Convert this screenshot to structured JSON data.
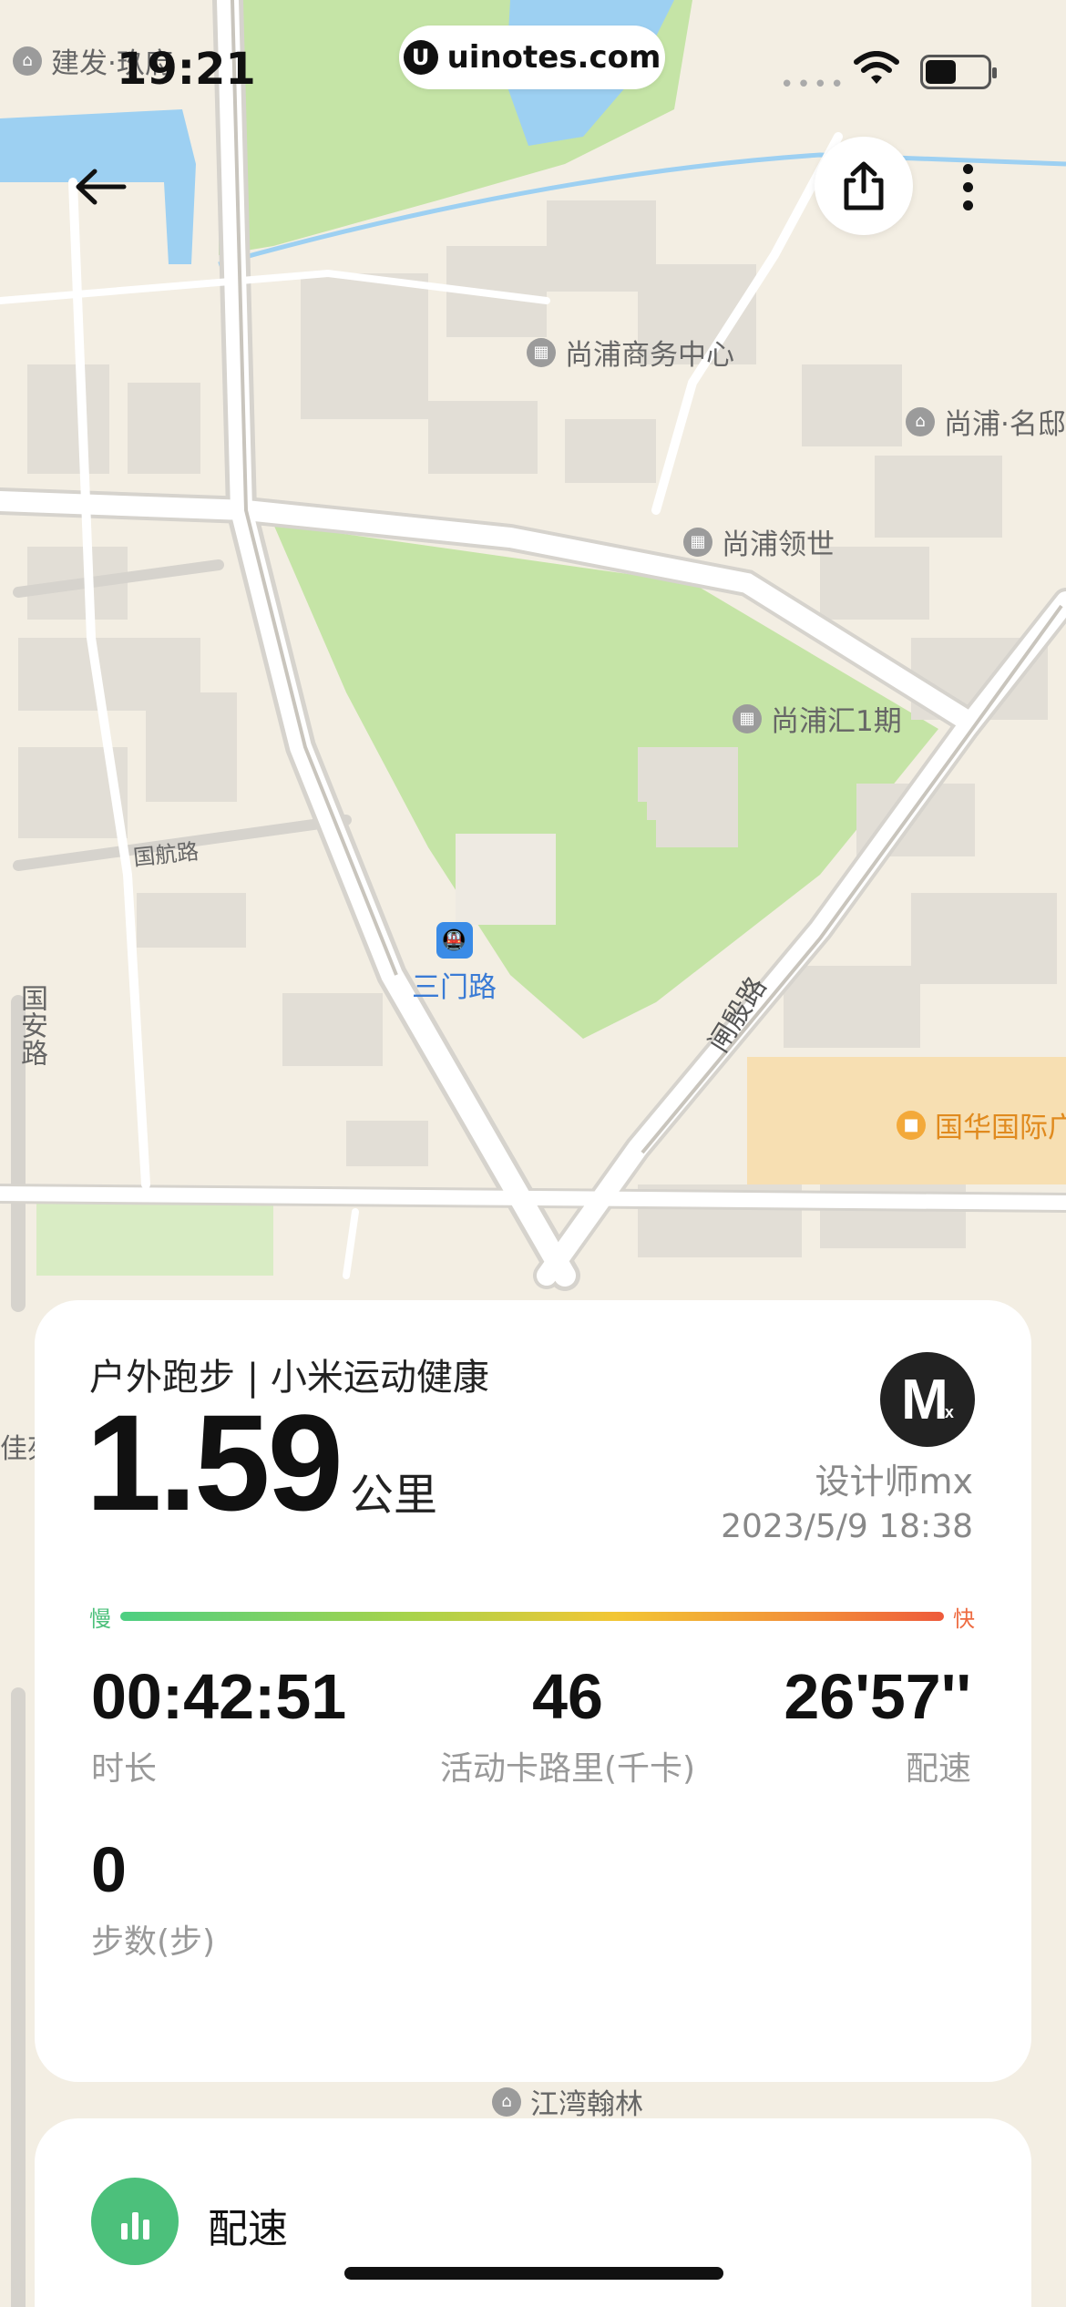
{
  "status_bar": {
    "time": "19:21",
    "url": "uinotes.com",
    "url_logo": "U",
    "signal_dots": "••••"
  },
  "map": {
    "pois": [
      {
        "id": "jianfa",
        "label": "建发·玖府",
        "style": "gray"
      },
      {
        "id": "shangpu_business",
        "label": "尚浦商务中心",
        "style": "gray"
      },
      {
        "id": "shangpu_mingdi",
        "label": "尚浦·名邸",
        "style": "gray"
      },
      {
        "id": "shangpu_lingshi",
        "label": "尚浦领世",
        "style": "gray"
      },
      {
        "id": "shangpuhui",
        "label": "尚浦汇1期",
        "style": "gray"
      },
      {
        "id": "guohua",
        "label": "国华国际广场",
        "style": "orange"
      },
      {
        "id": "jiangwan",
        "label": "江湾翰林",
        "style": "gray"
      }
    ],
    "roads": {
      "guohang": "国航路",
      "guoan": "国安路",
      "zhayin": "闸殷路",
      "guifang": "佳苑"
    },
    "metro": {
      "label": "三门路",
      "icon": "metro-icon"
    }
  },
  "activity": {
    "title": "户外跑步 | 小米运动健康",
    "distance": "1.59",
    "distance_unit": "公里",
    "avatar_text": "M",
    "designer": "设计师mx",
    "datetime": "2023/5/9 18:38",
    "pace_scale": {
      "slow": "慢",
      "fast": "快"
    },
    "metrics": [
      {
        "value": "00:42:51",
        "label": "时长"
      },
      {
        "value": "46",
        "label": "活动卡路里(千卡)"
      },
      {
        "value": "26'57''",
        "label": "配速"
      },
      {
        "value": "0",
        "label": "步数(步)"
      }
    ]
  },
  "pace_section": {
    "title": "配速",
    "icon": "bar-chart-icon"
  },
  "colors": {
    "accent_green": "#4cc07b",
    "fast_orange": "#ee5a3b",
    "park_green": "#c5e4a6",
    "map_bg": "#f3eee3"
  }
}
